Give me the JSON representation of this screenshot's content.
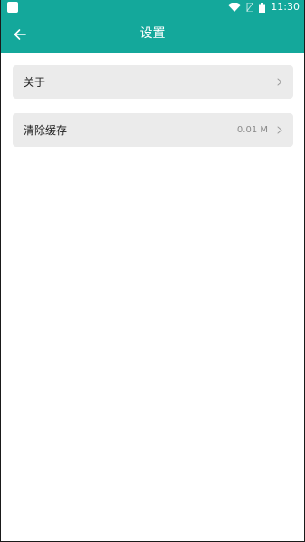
{
  "status_bar": {
    "time": "11:30"
  },
  "app_bar": {
    "title": "设置"
  },
  "settings": {
    "items": [
      {
        "label": "关于",
        "value": ""
      },
      {
        "label": "清除缓存",
        "value": "0.01 M"
      }
    ]
  },
  "colors": {
    "primary": "#14a89b",
    "item_background": "#ebebeb"
  },
  "icons": {
    "back": "arrow-left-icon",
    "chevron": "chevron-right-icon",
    "wifi": "wifi-icon",
    "sim": "sim-icon",
    "battery": "battery-icon"
  }
}
